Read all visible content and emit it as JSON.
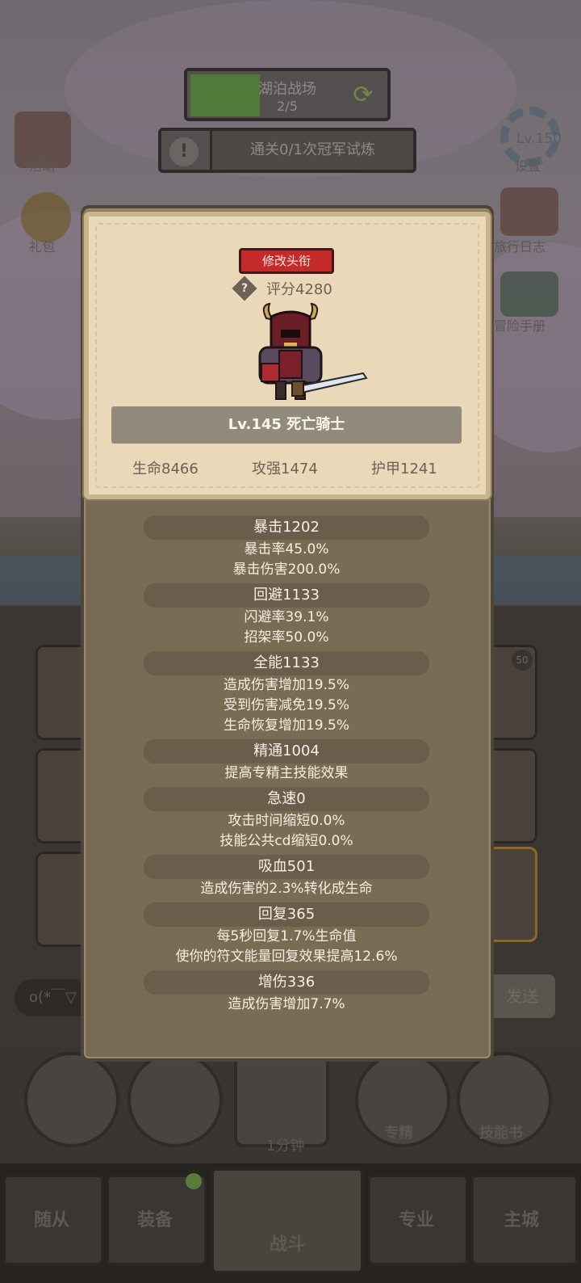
{
  "background": {
    "stage": {
      "name": "湖泊战场",
      "progress": "2/5"
    },
    "trial": {
      "text": "通关0/1次冠军试炼"
    },
    "left_buttons": [
      {
        "label": "活动"
      },
      {
        "label": "礼包"
      }
    ],
    "right_buttons": [
      {
        "label": "设置"
      },
      {
        "label": "旅行日志"
      },
      {
        "label": "冒险手册"
      }
    ],
    "level_text": "Lv.150",
    "chat": {
      "placeholder_text": "o(*￣▽",
      "send_label": "发送"
    },
    "action_buttons": [
      {
        "label": ""
      },
      {
        "label": ""
      },
      {
        "label": "1分钟"
      },
      {
        "label": "专精"
      },
      {
        "label": "技能书"
      }
    ],
    "tabs": [
      {
        "label": "随从"
      },
      {
        "label": "装备"
      },
      {
        "label": "战斗"
      },
      {
        "label": "专业"
      },
      {
        "label": "主城"
      }
    ],
    "badge_count": "50"
  },
  "profile": {
    "change_title_label": "修改头衔",
    "score": "评分4280",
    "name": "Lv.145 死亡骑士",
    "hp": "生命8466",
    "attack": "攻强1474",
    "armor": "护甲1241"
  },
  "stats": [
    {
      "header": "暴击1202",
      "lines": [
        "暴击率45.0%",
        "暴击伤害200.0%"
      ]
    },
    {
      "header": "回避1133",
      "lines": [
        "闪避率39.1%",
        "招架率50.0%"
      ]
    },
    {
      "header": "全能1133",
      "lines": [
        "造成伤害增加19.5%",
        "受到伤害减免19.5%",
        "生命恢复增加19.5%"
      ]
    },
    {
      "header": "精通1004",
      "lines": [
        "提高专精主技能效果"
      ]
    },
    {
      "header": "急速0",
      "lines": [
        "攻击时间缩短0.0%",
        "技能公共cd缩短0.0%"
      ]
    },
    {
      "header": "吸血501",
      "lines": [
        "造成伤害的2.3%转化成生命"
      ]
    },
    {
      "header": "回复365",
      "lines": [
        "每5秒回复1.7%生命值",
        "使你的符文能量回复效果提高12.6%"
      ]
    },
    {
      "header": "增伤336",
      "lines": [
        "造成伤害增加7.7%"
      ]
    }
  ]
}
